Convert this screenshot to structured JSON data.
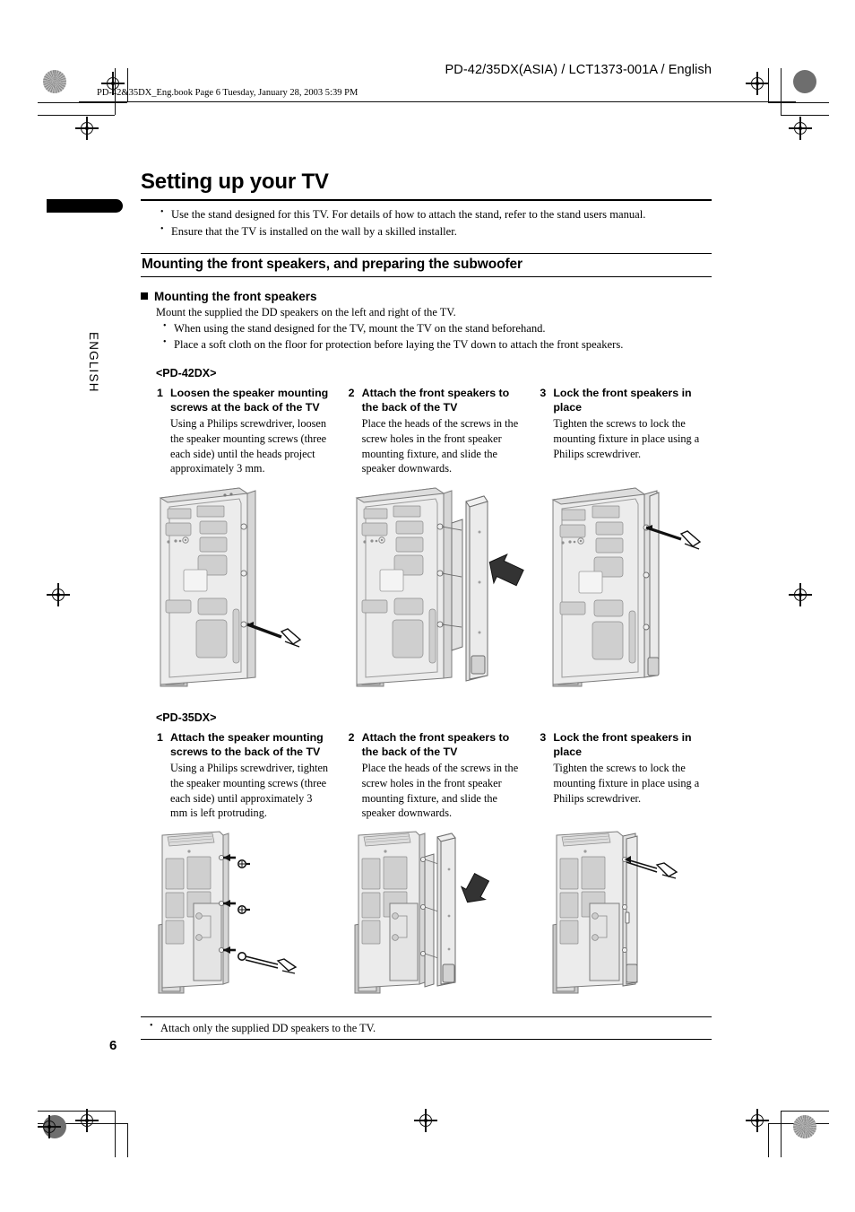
{
  "header": {
    "model_line": "PD-42/35DX(ASIA) / LCT1373-001A / English",
    "book_line": "PD-42&35DX_Eng.book  Page 6  Tuesday, January 28, 2003  5:39 PM"
  },
  "sidebar": {
    "language_tab": "ENGLISH"
  },
  "main": {
    "title": "Setting up your TV",
    "intro_bullets": [
      "Use the stand designed for this TV. For details of how to attach the stand, refer to the stand users manual.",
      "Ensure that the TV is installed on the wall by a skilled installer."
    ],
    "section_heading": "Mounting the front speakers, and preparing the subwoofer",
    "subsection": {
      "heading": "Mounting the front speakers",
      "intro": "Mount the supplied the DD speakers on the left and right of the TV.",
      "bullets": [
        "When using the stand designed for the TV, mount the TV on the stand beforehand.",
        "Place a soft cloth on the floor for protection before laying the TV down to attach the front speakers."
      ]
    },
    "model_42_label": "<PD-42DX>",
    "model_42_steps": [
      {
        "num": "1",
        "title": "Loosen the speaker mounting screws at the back of the TV",
        "body": "Using a Philips screwdriver, loosen the speaker mounting screws (three each side) until the heads project approximately 3 mm."
      },
      {
        "num": "2",
        "title": "Attach the front speakers to the back of the TV",
        "body": "Place the heads of the screws in the screw holes in the front speaker mounting fixture, and slide the speaker downwards."
      },
      {
        "num": "3",
        "title": "Lock the front speakers in place",
        "body": "Tighten the screws to lock the mounting fixture in place using a Philips screwdriver."
      }
    ],
    "model_35_label": "<PD-35DX>",
    "model_35_steps": [
      {
        "num": "1",
        "title": "Attach the speaker mounting screws to the back of the TV",
        "body": "Using a Philips screwdriver, tighten the speaker mounting screws (three each side) until approximately 3 mm is left protruding."
      },
      {
        "num": "2",
        "title": "Attach the front speakers to the back of the TV",
        "body": "Place the heads of the screws in the screw holes in the front speaker mounting fixture, and slide the speaker downwards."
      },
      {
        "num": "3",
        "title": "Lock the front speakers in place",
        "body": "Tighten the screws to lock the mounting fixture in place using a Philips screwdriver."
      }
    ],
    "footnote": "Attach only the supplied DD speakers to the TV.",
    "page_number": "6"
  },
  "figures": {
    "fig_42_1": "tv-back-42dx-loosen-screws-illustration",
    "fig_42_2": "tv-back-42dx-attach-speaker-illustration",
    "fig_42_3": "tv-back-42dx-tighten-screws-illustration",
    "fig_35_1": "tv-back-35dx-attach-screws-illustration",
    "fig_35_2": "tv-back-35dx-attach-speaker-illustration",
    "fig_35_3": "tv-back-35dx-tighten-screws-illustration"
  },
  "colors": {
    "ink": "#000000",
    "panel_fill": "#e9e9e9",
    "panel_shade": "#d2d2d2",
    "panel_dark": "#b9b9b9",
    "reg_mark": "#111111"
  }
}
